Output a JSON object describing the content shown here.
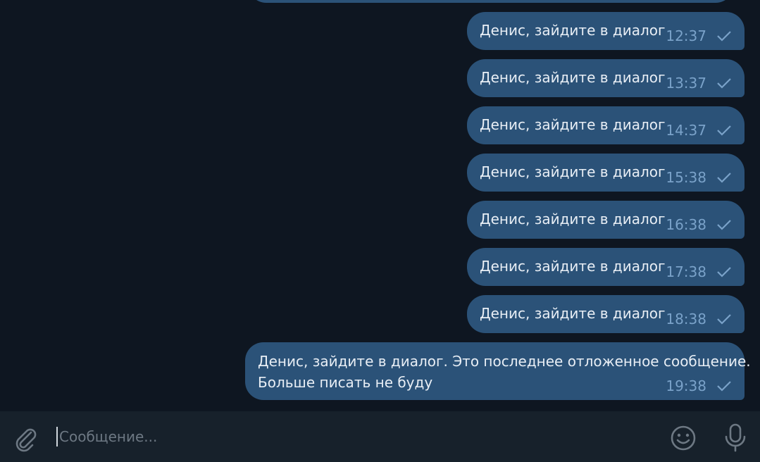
{
  "messages": [
    {
      "text": "Денис, зайдите в диалог",
      "time": "12:37"
    },
    {
      "text": "Денис, зайдите в диалог",
      "time": "13:37"
    },
    {
      "text": "Денис, зайдите в диалог",
      "time": "14:37"
    },
    {
      "text": "Денис, зайдите в диалог",
      "time": "15:38"
    },
    {
      "text": "Денис, зайдите в диалог",
      "time": "16:38"
    },
    {
      "text": "Денис, зайдите в диалог",
      "time": "17:38"
    },
    {
      "text": "Денис, зайдите в диалог",
      "time": "18:38"
    },
    {
      "text": "Денис, зайдите в диалог. Это последнее отложенное сообщение.\nБольше писать не буду",
      "time": "19:38"
    }
  ],
  "composer": {
    "placeholder": "Сообщение...",
    "value": ""
  },
  "icons": {
    "attach": "paperclip-icon",
    "emoji": "smile-icon",
    "mic": "microphone-icon",
    "status": "checkmark-icon"
  },
  "colors": {
    "background": "#0e1621",
    "bubble": "#2b5278",
    "composer": "#17212b",
    "meta": "#7aa2c9"
  }
}
